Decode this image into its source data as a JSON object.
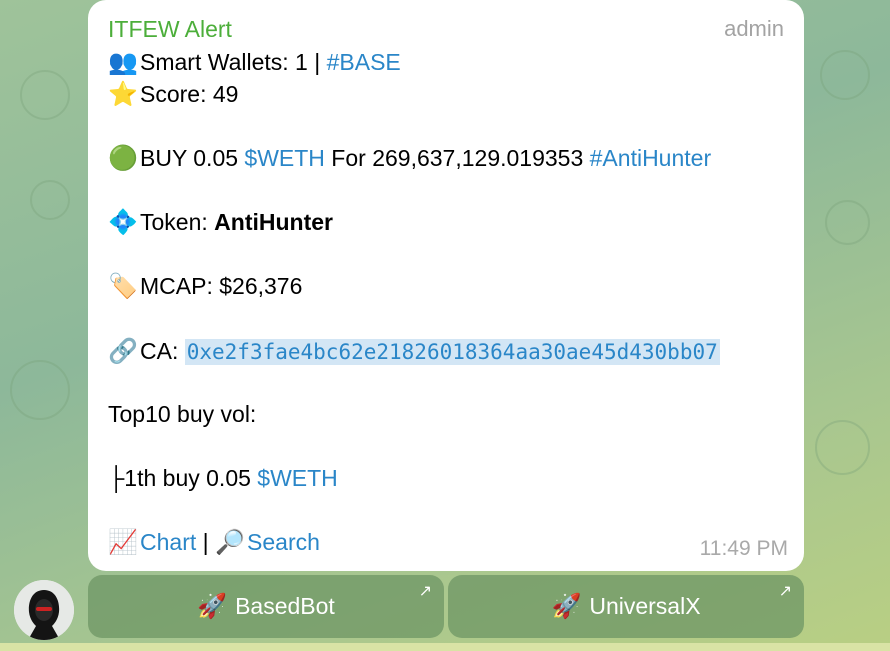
{
  "message": {
    "sender": "ITFEW Alert",
    "role": "admin",
    "wallets_icon": "👥",
    "wallets_label": "Smart Wallets: 1 | ",
    "wallets_tag": "#BASE",
    "score_icon": "⭐",
    "score_label": "Score: 49",
    "buy_icon": "🟢",
    "buy_prefix": "BUY 0.05 ",
    "buy_token_link": "$WETH",
    "buy_middle": " For 269,637,129.019353 ",
    "buy_tag": "#AntiHunter",
    "token_icon": "💠",
    "token_label": "Token: ",
    "token_name": "AntiHunter",
    "mcap_icon": "🏷️",
    "mcap_label": "MCAP: $26,376",
    "ca_icon": "🔗",
    "ca_label": "CA: ",
    "ca_value": "0xe2f3fae4bc62e2182601836 4aa30ae45d430bb07",
    "top10_label": "Top10 buy vol:",
    "top_buy_prefix": "├1th buy 0.05 ",
    "top_buy_link": "$WETH",
    "chart_icon": "📈",
    "chart_link": "Chart",
    "separator": " | ",
    "search_icon": "🔎",
    "search_link": "Search",
    "time": "11:49 PM"
  },
  "buttons": [
    {
      "icon": "🚀",
      "label": "BasedBot"
    },
    {
      "icon": "🚀",
      "label": "UniversalX"
    }
  ]
}
